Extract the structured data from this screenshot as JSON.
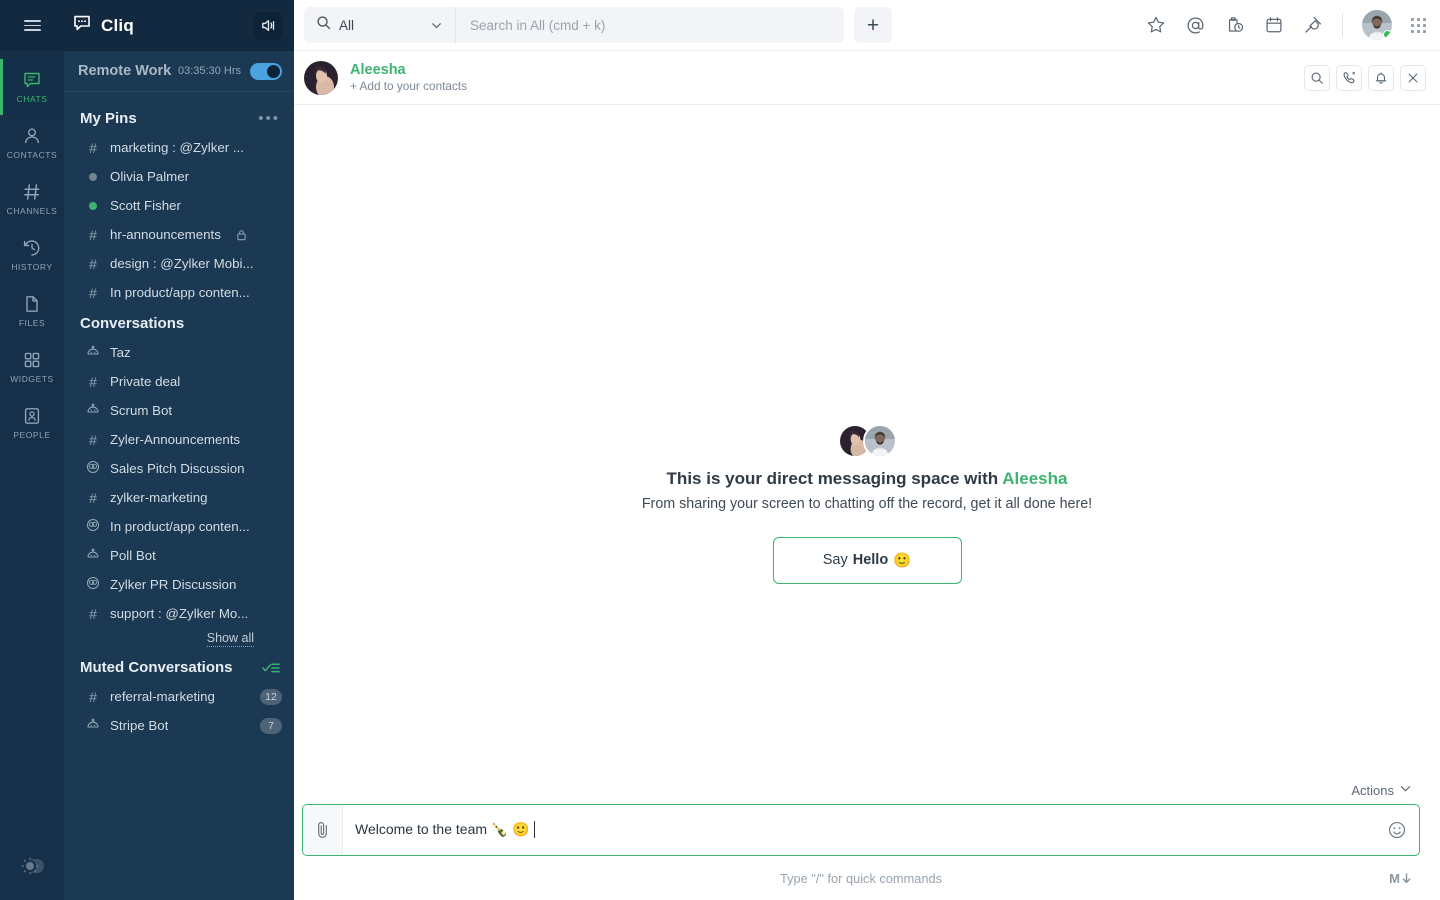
{
  "app": {
    "brand": "Cliq",
    "logo_icon": "chat-bubble-dots-icon",
    "hamburger_icon": "hamburger-menu-icon",
    "speaker_icon": "speaker-volume-icon",
    "theme_toggle_icon": "sun-theme-toggle-icon",
    "accent_green": "#3cb371",
    "sidebar_bg": "#1b3952",
    "rail_bg": "#16304a"
  },
  "rail": {
    "items": [
      {
        "label": "CHATS",
        "icon": "chats-icon",
        "active": true
      },
      {
        "label": "CONTACTS",
        "icon": "contacts-person-icon",
        "active": false
      },
      {
        "label": "CHANNELS",
        "icon": "channels-hash-icon",
        "active": false
      },
      {
        "label": "HISTORY",
        "icon": "history-clock-icon",
        "active": false
      },
      {
        "label": "FILES",
        "icon": "files-document-icon",
        "active": false
      },
      {
        "label": "WIDGETS",
        "icon": "widgets-grid-icon",
        "active": false
      },
      {
        "label": "PEOPLE",
        "icon": "people-card-icon",
        "active": false
      }
    ]
  },
  "status": {
    "name": "Remote Work",
    "time": "03:35:30 Hrs",
    "toggle_on": true
  },
  "sidebar": {
    "pins": {
      "title": "My Pins",
      "menu_icon": "more-options-icon",
      "items": [
        {
          "label": "marketing : @Zylker ...",
          "icon": "hash-icon"
        },
        {
          "label": "Olivia Palmer",
          "icon": "presence-dot-offline-icon"
        },
        {
          "label": "Scott Fisher",
          "icon": "presence-dot-online-icon"
        },
        {
          "label": "hr-announcements",
          "icon": "hash-icon",
          "lock": true
        },
        {
          "label": "design : @Zylker Mobi...",
          "icon": "hash-icon"
        },
        {
          "label": "In product/app conten...",
          "icon": "hash-icon"
        }
      ]
    },
    "conversations": {
      "title": "Conversations",
      "items": [
        {
          "label": "Taz",
          "icon": "bot-icon"
        },
        {
          "label": "Private deal",
          "icon": "hash-icon"
        },
        {
          "label": "Scrum Bot",
          "icon": "bot-icon"
        },
        {
          "label": "Zyler-Announcements",
          "icon": "hash-icon"
        },
        {
          "label": "Sales Pitch Discussion",
          "icon": "group-chat-icon"
        },
        {
          "label": "zylker-marketing",
          "icon": "hash-icon"
        },
        {
          "label": "In product/app conten...",
          "icon": "group-chat-icon"
        },
        {
          "label": "Poll Bot",
          "icon": "bot-icon"
        },
        {
          "label": "Zylker PR Discussion",
          "icon": "group-chat-icon"
        },
        {
          "label": "support : @Zylker Mo...",
          "icon": "hash-icon"
        }
      ],
      "show_all": "Show all"
    },
    "muted": {
      "title": "Muted Conversations",
      "action_icon": "mark-all-read-icon",
      "items": [
        {
          "label": "referral-marketing",
          "icon": "hash-icon",
          "badge": "12"
        },
        {
          "label": "Stripe Bot",
          "icon": "bot-icon",
          "badge": "7"
        }
      ]
    }
  },
  "topbar": {
    "search_scope": "All",
    "search_scope_icon": "search-icon",
    "search_caret_icon": "chevron-down-icon",
    "search_placeholder": "Search in All (cmd + k)",
    "search_value": "",
    "new_chat_label": "+",
    "icons": [
      {
        "name": "star-favorites-icon"
      },
      {
        "name": "mention-at-icon"
      },
      {
        "name": "reminders-clock-icon"
      },
      {
        "name": "calendar-icon"
      },
      {
        "name": "integrations-plug-icon"
      }
    ],
    "avatar_icon": "user-avatar",
    "apps_grid_icon": "apps-grid-icon"
  },
  "chat_header": {
    "avatar_icon": "contact-avatar",
    "name": "Aleesha",
    "subtitle": "+ Add to your contacts",
    "actions": [
      {
        "name": "search-in-chat-icon"
      },
      {
        "name": "call-phone-icon"
      },
      {
        "name": "notification-bell-icon"
      },
      {
        "name": "close-chat-icon"
      }
    ]
  },
  "welcome": {
    "title_prefix": "This is your direct messaging space with ",
    "title_name": "Aleesha",
    "subtitle": "From sharing your screen to chatting off the record, get it all done here!",
    "cta_prefix": "Say ",
    "cta_bold": "Hello",
    "cta_emoji": "🙂"
  },
  "composer": {
    "actions_label": "Actions",
    "actions_caret_icon": "chevron-down-icon",
    "attach_icon": "attachment-paperclip-icon",
    "message_value": "Welcome to the team 🍾 🙂",
    "emoji_icon": "emoji-smiley-icon",
    "hint": "Type \"/\" for quick commands",
    "markdown_label": "M",
    "markdown_icon": "markdown-down-arrow-icon"
  }
}
